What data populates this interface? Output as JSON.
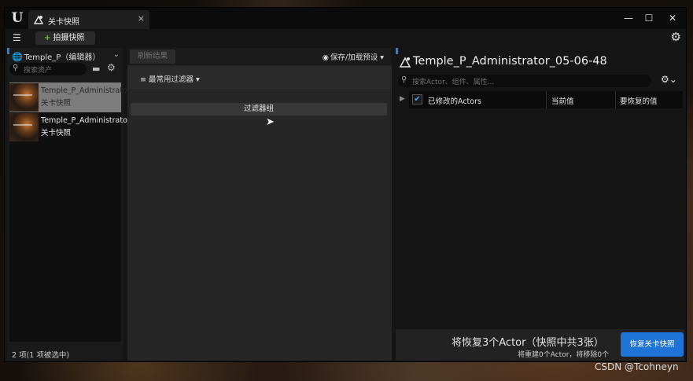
{
  "window": {
    "tab_title": "关卡快照",
    "tab_close": "×",
    "controls": {
      "minimize": "—",
      "maximize": "☐",
      "close": "✕"
    }
  },
  "toolbar": {
    "menu_icon": "list-icon",
    "snapshot_button_plus": "+",
    "snapshot_button": "拍摄快照",
    "settings_icon": "gear-icon"
  },
  "left_panel": {
    "level_label": "Temple_P（编辑器）",
    "search_placeholder": "搜索资产",
    "items": [
      {
        "name": "Temple_P_Administrator",
        "sub": "关卡快照",
        "selected": true
      },
      {
        "name": "Temple_P_Administrator",
        "sub": "关卡快照",
        "selected": false
      }
    ],
    "status": "2 项(1 项被选中)"
  },
  "middle_panel": {
    "refresh_button": "刷新结果",
    "preset_button": "保存/加载预设",
    "common_filters": "最常用过滤器",
    "filter_group": "过滤器组"
  },
  "right_panel": {
    "title": "Temple_P_Administrator_05-06-48",
    "search_placeholder": "搜索Actor、组件、属性...",
    "columns": {
      "modified": "已修改的Actors",
      "current": "当前值",
      "restore": "要恢复的值"
    },
    "checked": true,
    "restore_summary": "将恢复3个Actor（快照中共3张）",
    "restore_detail": "将重建0个Actor，将移除0个",
    "restore_button": "恢复关卡快照"
  },
  "watermark": "CSDN @Tcohneyn",
  "colors": {
    "accent_blue": "#1d73d6",
    "plus_green": "#6fbf4a"
  }
}
